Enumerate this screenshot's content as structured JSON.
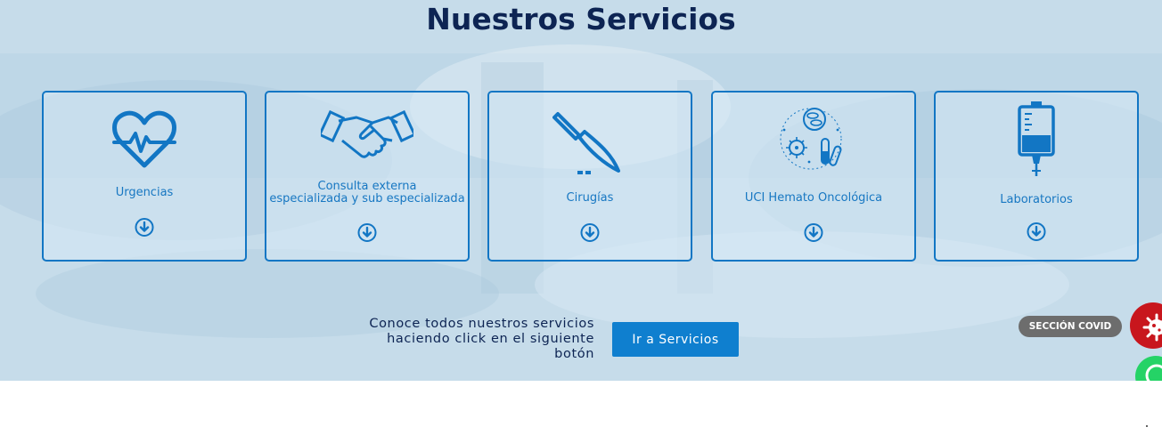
{
  "section": {
    "title": "Nuestros Servicios"
  },
  "services": [
    {
      "label_lines": [
        "Urgencias"
      ],
      "icon": "heartbeat-icon",
      "arrow_icon": "arrow-down-circle-icon"
    },
    {
      "label_lines": [
        "Consulta externa",
        "especializada y sub especializada"
      ],
      "icon": "handshake-icon",
      "arrow_icon": "arrow-down-circle-icon"
    },
    {
      "label_lines": [
        "Cirugías"
      ],
      "icon": "scalpel-icon",
      "arrow_icon": "arrow-down-circle-icon"
    },
    {
      "label_lines": [
        "UCI Hemato Oncológica"
      ],
      "icon": "blood-cells-icon",
      "arrow_icon": "arrow-down-circle-icon"
    },
    {
      "label_lines": [
        "Laboratorios"
      ],
      "icon": "iv-bag-icon",
      "arrow_icon": "arrow-down-circle-icon"
    }
  ],
  "cta": {
    "text_lines": [
      "Conoce todos nuestros servicios",
      "haciendo click en el siguiente",
      "botón"
    ],
    "button_label": "Ir a Servicios"
  },
  "floating": {
    "covid_label": "SECCIÓN COVID",
    "covid_icon": "virus-icon",
    "whatsapp_icon": "whatsapp-icon"
  },
  "colors": {
    "title": "#0d2453",
    "card_border": "#1276c4",
    "icon_blue": "#1276c4",
    "button_bg": "#0f7fcf",
    "covid_pill": "#6d6d6d",
    "covid_icon_bg": "#c8161d",
    "whatsapp_green": "#25d366"
  }
}
